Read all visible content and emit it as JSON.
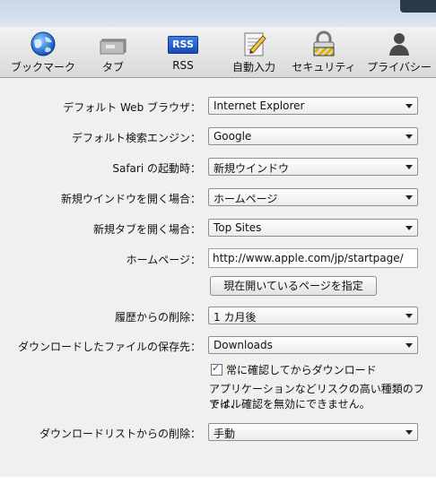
{
  "toolbar": {
    "items": [
      {
        "label": "ブックマーク",
        "icon": "globe-icon"
      },
      {
        "label": "タブ",
        "icon": "tabs-icon"
      },
      {
        "label": "RSS",
        "icon": "rss-icon"
      },
      {
        "label": "自動入力",
        "icon": "autofill-icon"
      },
      {
        "label": "セキュリティ",
        "icon": "lock-icon"
      },
      {
        "label": "プライバシー",
        "icon": "person-icon"
      }
    ],
    "rss_badge": "RSS"
  },
  "general": {
    "default_browser": {
      "label": "デフォルト Web ブラウザ：",
      "value": "Internet Explorer"
    },
    "default_search": {
      "label": "デフォルト検索エンジン：",
      "value": "Google"
    },
    "safari_opens": {
      "label": "Safari の起動時：",
      "value": "新規ウインドウ"
    },
    "new_window": {
      "label": "新規ウインドウを開く場合：",
      "value": "ホームページ"
    },
    "new_tab": {
      "label": "新規タブを開く場合：",
      "value": "Top Sites"
    },
    "homepage": {
      "label": "ホームページ：",
      "value": "http://www.apple.com/jp/startpage/"
    },
    "set_current_button": "現在開いているページを指定",
    "history_remove": {
      "label": "履歴からの削除：",
      "value": "1 カ月後"
    },
    "download_location": {
      "label": "ダウンロードしたファイルの保存先：",
      "value": "Downloads"
    },
    "ask_before_download": {
      "label": "常に確認してからダウンロード",
      "checked": true
    },
    "download_note_line1": "アプリケーションなどリスクの高い種類のファイル",
    "download_note_line2": "では、確認を無効にできません。",
    "download_list_remove": {
      "label": "ダウンロードリストからの削除：",
      "value": "手動"
    }
  }
}
